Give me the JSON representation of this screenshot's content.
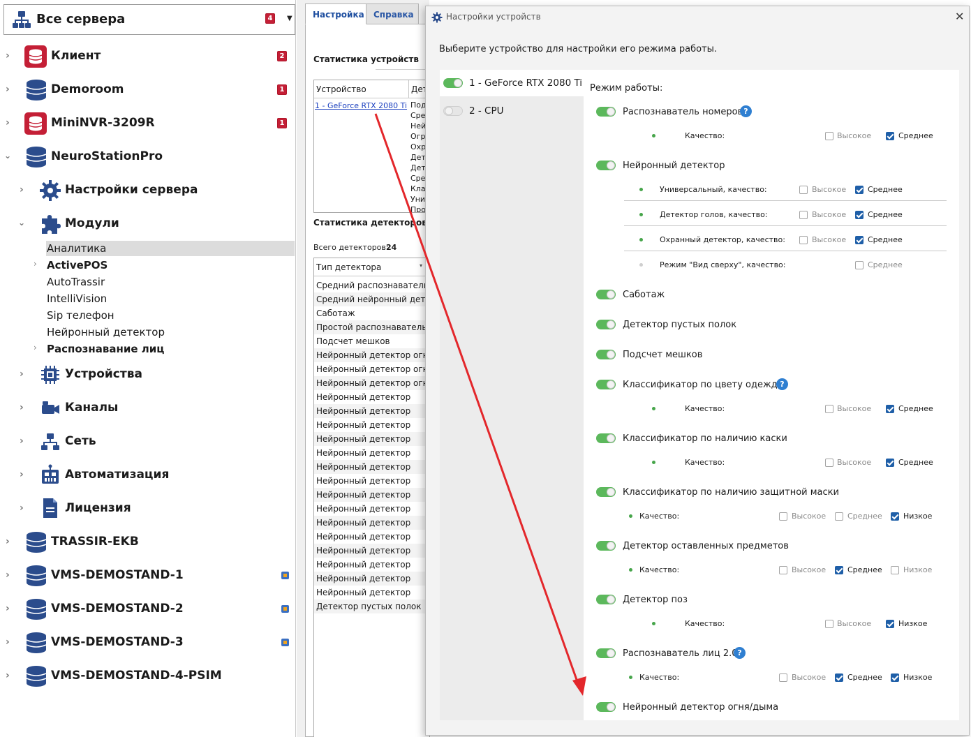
{
  "colors": {
    "accent": "#1f5fa8",
    "toggle_on": "#5cb85c",
    "badge": "#c41f36",
    "annotation_arrow": "#e3272b"
  },
  "tree": {
    "header": {
      "title": "Все сервера",
      "badge": "4",
      "icon": "network-icon",
      "dropdown_icon": "chevron-down-icon"
    },
    "servers": [
      {
        "label": "Клиент",
        "badge": "2",
        "icon": "red-server-icon"
      },
      {
        "label": "Demoroom",
        "badge": "1",
        "icon": "database-icon"
      },
      {
        "label": "MiniNVR-3209R",
        "badge": "1",
        "icon": "red-server-icon"
      },
      {
        "label": "NeuroStationPro",
        "icon": "database-icon",
        "expanded": true
      }
    ],
    "neuro_children": [
      {
        "label": "Настройки сервера",
        "icon": "gear-icon"
      },
      {
        "label": "Модули",
        "icon": "puzzle-icon",
        "expanded": true
      }
    ],
    "modules": [
      {
        "label": "Аналитика",
        "selected": true
      },
      {
        "label": "ActivePOS",
        "bold": true,
        "has_children": true
      },
      {
        "label": "AutoTrassir"
      },
      {
        "label": "IntelliVision"
      },
      {
        "label": "Sip телефон"
      },
      {
        "label": "Нейронный детектор"
      },
      {
        "label": "Распознавание лиц",
        "bold": true,
        "has_children": true
      }
    ],
    "neuro_more": [
      {
        "label": "Устройства",
        "icon": "chip-icon"
      },
      {
        "label": "Каналы",
        "icon": "camera-icon"
      },
      {
        "label": "Сеть",
        "icon": "network-icon"
      },
      {
        "label": "Автоматизация",
        "icon": "robot-icon"
      },
      {
        "label": "Лицензия",
        "icon": "document-icon"
      }
    ],
    "other_servers": [
      {
        "label": "TRASSIR-EKB",
        "icon": "database-icon"
      },
      {
        "label": "VMS-DEMOSTAND-1",
        "icon": "database-icon",
        "cube": true
      },
      {
        "label": "VMS-DEMOSTAND-2",
        "icon": "database-icon",
        "cube": true
      },
      {
        "label": "VMS-DEMOSTAND-3",
        "icon": "database-icon",
        "cube": true
      },
      {
        "label": "VMS-DEMOSTAND-4-PSIM",
        "icon": "database-icon"
      }
    ]
  },
  "mid": {
    "tabs": [
      "Настройка",
      "Справка"
    ],
    "devices_title": "Статистика устройств",
    "col_device": "Устройство",
    "col_details": "Дет",
    "device_link": "1 - GeForce RTX 2080 Ti",
    "device_details": [
      "Под",
      "Сред",
      "Ней",
      "Огра",
      "Охра",
      "Дете",
      "Дете",
      "Сред",
      "Клас",
      "Унив",
      "Про"
    ],
    "detectors_title": "Статистика детекторов",
    "total_label": "Всего детекторов:",
    "total_value": "24",
    "col_type": "Тип детектора",
    "rows": [
      "Средний распознаватель но",
      "Средний нейронный детекто",
      "Саботаж",
      "Простой распознаватель ли",
      "Подсчет мешков",
      "Нейронный детектор огня/д",
      "Нейронный детектор огня/д",
      "Нейронный детектор огня/д",
      "Нейронный детектор",
      "Нейронный детектор",
      "Нейронный детектор",
      "Нейронный детектор",
      "Нейронный детектор",
      "Нейронный детектор",
      "Нейронный детектор",
      "Нейронный детектор",
      "Нейронный детектор",
      "Нейронный детектор",
      "Нейронный детектор",
      "Нейронный детектор",
      "Нейронный детектор",
      "Нейронный детектор",
      "Нейронный детектор",
      "Детектор пустых полок"
    ]
  },
  "dialog": {
    "title": "Настройки устройств",
    "instruction": "Выберите устройство для настройки его режима работы.",
    "devices": [
      {
        "label": "1 - GeForce RTX 2080 Ti",
        "on": true,
        "selected": true
      },
      {
        "label": "2 - CPU",
        "on": false,
        "selected": false
      }
    ],
    "mode_title": "Режим работы:",
    "q_high": "Высокое",
    "q_mid": "Среднее",
    "q_low": "Низкое",
    "quality": "Качество:",
    "modes": {
      "plates": "Распознаватель номеров",
      "neural": "Нейронный детектор",
      "neural_sub": [
        "Универсальный, качество:",
        "Детектор голов, качество:",
        "Охранный детектор, качество:",
        "Режим \"Вид сверху\", качество:"
      ],
      "sabotage": "Саботаж",
      "shelves": "Детектор пустых полок",
      "bags": "Подсчет мешков",
      "clothes": "Классификатор по цвету одежды",
      "helmet": "Классификатор по наличию каски",
      "mask": "Классификатор по наличию защитной маски",
      "left_items": "Детектор оставленных предметов",
      "poses": "Детектор поз",
      "faces": "Распознаватель лиц 2.0",
      "fire": "Нейронный детектор огня/дыма"
    }
  }
}
